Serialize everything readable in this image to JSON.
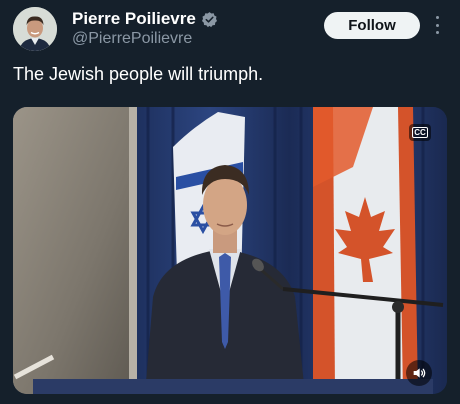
{
  "author": {
    "display_name": "Pierre Poilievre",
    "handle": "@PierrePoilievre",
    "verified": true,
    "avatar_icon": "profile-photo"
  },
  "actions": {
    "follow_label": "Follow",
    "more_icon": "more-vertical-icon"
  },
  "tweet": {
    "text": "The Jewish people will triumph."
  },
  "media": {
    "type": "video",
    "cc_label": "CC",
    "volume_icon": "volume-icon"
  },
  "colors": {
    "background": "#15202b",
    "follow_bg": "#eff3f4",
    "verified_badge": "#8b98a5",
    "handle": "#8b98a5"
  }
}
